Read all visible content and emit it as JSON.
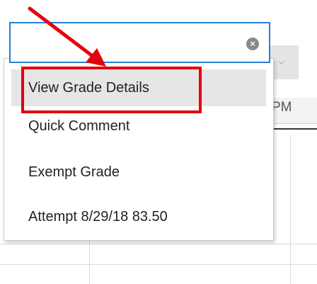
{
  "search": {
    "value": "",
    "placeholder": ""
  },
  "menu": {
    "items": [
      {
        "label": "View Grade Details",
        "highlighted": true
      },
      {
        "label": "Quick Comment",
        "highlighted": false
      },
      {
        "label": "Exempt Grade",
        "highlighted": false
      },
      {
        "label": "Attempt 8/29/18 83.50",
        "highlighted": false
      }
    ]
  },
  "background": {
    "column_header_fragment": "PM"
  },
  "icons": {
    "clear": "clear-circle-icon",
    "chevron": "chevron-down-icon",
    "annotation_arrow": "red-arrow-annotation"
  },
  "colors": {
    "focus_border": "#2a7fd4",
    "annotation_red": "#e3000f",
    "highlight": "#e6e6e6"
  }
}
